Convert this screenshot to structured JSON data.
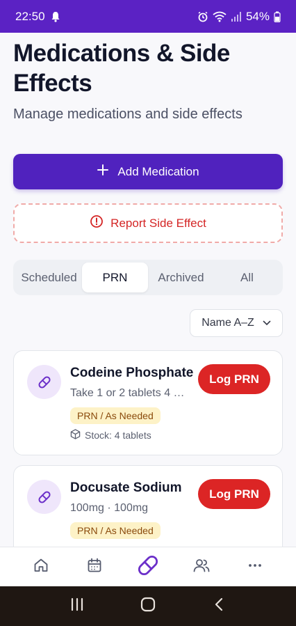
{
  "status_bar": {
    "time": "22:50",
    "battery": "54%"
  },
  "header": {
    "title": "Medications & Side Effects",
    "subtitle": "Manage medications and side effects"
  },
  "actions": {
    "add_label": "Add Medication",
    "report_label": "Report Side Effect"
  },
  "tabs": [
    {
      "label": "Scheduled",
      "active": false
    },
    {
      "label": "PRN",
      "active": true
    },
    {
      "label": "Archived",
      "active": false
    },
    {
      "label": "All",
      "active": false
    }
  ],
  "sort": {
    "value": "Name A–Z"
  },
  "medications": [
    {
      "name": "Codeine Phosphate",
      "description": "Take 1 or 2 tablets 4 …",
      "badge": "PRN / As Needed",
      "stock": "Stock: 4 tablets",
      "action_label": "Log PRN"
    },
    {
      "name": "Docusate Sodium",
      "description": "100mg · 100mg",
      "badge": "PRN / As Needed",
      "stock": "",
      "action_label": "Log PRN"
    }
  ],
  "bottom_nav": [
    {
      "icon": "home-icon"
    },
    {
      "icon": "calendar-icon"
    },
    {
      "icon": "pill-icon",
      "active": true
    },
    {
      "icon": "people-icon"
    },
    {
      "icon": "more-icon"
    }
  ],
  "colors": {
    "primary": "#5022be",
    "status_bar": "#5b22c4",
    "danger": "#dc2525",
    "badge_bg": "#fdf2c7",
    "badge_text": "#8a4a0c"
  }
}
